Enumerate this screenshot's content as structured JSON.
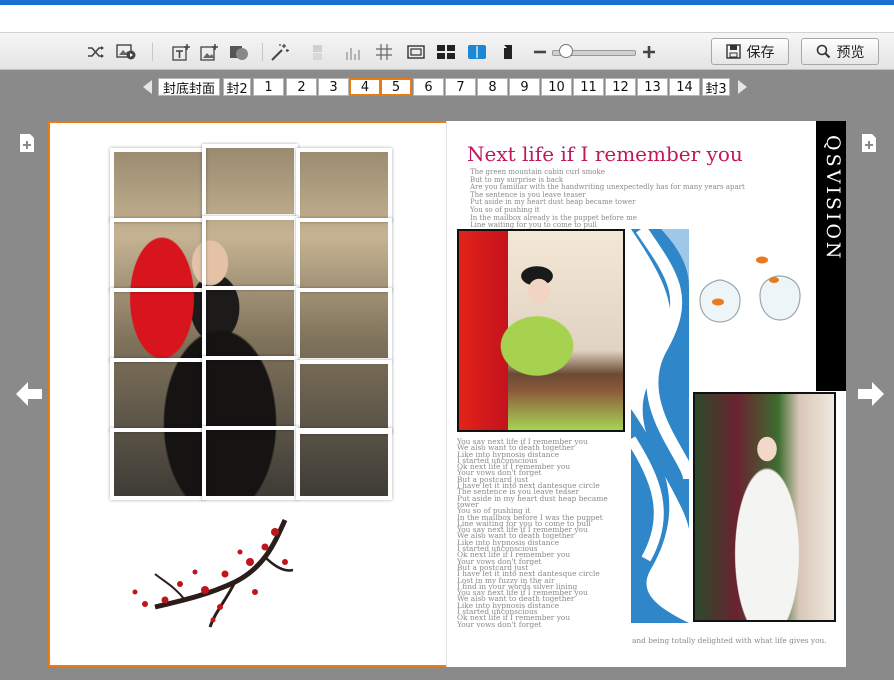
{
  "toolbar": {
    "save_label": "保存",
    "preview_label": "预览",
    "icons": [
      "shuffle-icon",
      "image-video-icon",
      "add-text-icon",
      "add-image-icon",
      "add-shape-icon",
      "magic-wand-icon",
      "layer-icon",
      "bar-icon",
      "grid-icon",
      "frame-icon",
      "layout-icon",
      "book-spread-icon",
      "single-page-icon",
      "zoom-out-icon",
      "zoom-in-icon"
    ]
  },
  "page_nav": {
    "tabs": [
      {
        "label": "封底封面",
        "active": false
      },
      {
        "label": "封2",
        "active": false
      },
      {
        "label": "1",
        "active": false
      },
      {
        "label": "2",
        "active": false
      },
      {
        "label": "3",
        "active": false
      },
      {
        "label": "4",
        "active": true
      },
      {
        "label": "5",
        "active": true
      },
      {
        "label": "6",
        "active": false
      },
      {
        "label": "7",
        "active": false
      },
      {
        "label": "8",
        "active": false
      },
      {
        "label": "9",
        "active": false
      },
      {
        "label": "10",
        "active": false
      },
      {
        "label": "11",
        "active": false
      },
      {
        "label": "12",
        "active": false
      },
      {
        "label": "13",
        "active": false
      },
      {
        "label": "14",
        "active": false
      },
      {
        "label": "封3",
        "active": false
      }
    ]
  },
  "album": {
    "title": "Next life if I remember you",
    "brand": "QSVISION",
    "poem_top": [
      "The green mountain cabin curl smoke",
      "But to my surprise is back",
      "Are you familiar with the handwriting unexpectedly has for many years apart",
      "The sentence is you leave teaser",
      "Put aside in my heart dust heap became tower",
      "You so of pushing it",
      "In the mailbox already is the puppet before me",
      "Line waiting for you to come to pull"
    ],
    "poem_bottom": [
      "You say next life if I remember you",
      "We also want to death together",
      "Like into hypnosis distance",
      "I started unconscious",
      "Ok next life if I remember you",
      "Your vows don't forget",
      "But a postcard just",
      "I have let it into next dantesque circle",
      "The sentence is you leave teaser",
      "Put aside in my heart dust heap became",
      "tower",
      "You so of pushing it",
      "In the mailbox before I was the puppet",
      "Line waiting for you to come to pull",
      "You say next life if I remember you",
      "We also want to death together",
      "Like into hypnosis distance",
      "I started unconscious",
      "Ok next life if I remember you",
      "Your vows don't forget",
      "But a postcard just",
      "I have let it into next dantesque circle",
      "Lost in my fuzzy in the air",
      "I find in your words silver lining",
      "You say next life if I remember you",
      "We also want to death together",
      "Like into hypnosis distance",
      "I started unconscious",
      "Ok next life if I remember you",
      "Your vows don't forget"
    ],
    "footer": "and being totally delighted with what life gives you."
  },
  "colors": {
    "accent_orange": "#e97b12",
    "title_pink": "#c2185b",
    "top_blue": "#1a6fd6"
  }
}
